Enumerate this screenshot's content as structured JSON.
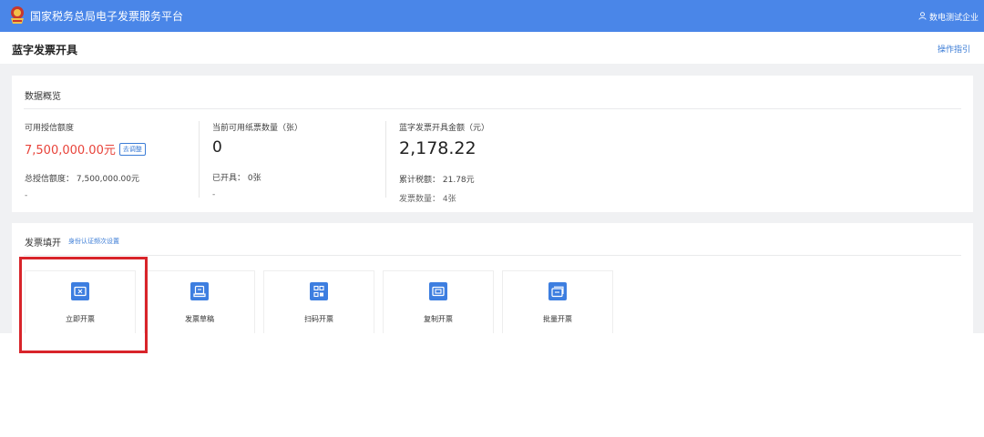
{
  "header": {
    "app_title": "国家税务总局电子发票服务平台",
    "user_name": "数电测试企业",
    "logo_icon": "tax-bureau-emblem-icon",
    "user_icon": "user-icon"
  },
  "page": {
    "title": "蓝字发票开具",
    "guide_link": "操作指引"
  },
  "overview": {
    "title": "数据概览",
    "credit": {
      "label": "可用授信额度",
      "value": "7,500,000.00元",
      "adjust_label": "去调整",
      "total_label": "总授信额度：",
      "total_value": "7,500,000.00元",
      "extra": "-"
    },
    "paper": {
      "label": "当前可用纸票数量（张）",
      "value": "0",
      "issued_label": "已开具：",
      "issued_value": "0张",
      "extra": "-"
    },
    "amount": {
      "label": "蓝字发票开具金额（元）",
      "value": "2,178.22",
      "tax_label": "累计税额：",
      "tax_value": "21.78元",
      "count_label": "发票数量：",
      "count_value": "4张"
    }
  },
  "invoice_fill": {
    "title": "发票填开",
    "auth_link": "身份认证频次设置",
    "tiles": [
      {
        "label": "立即开票",
        "icon": "ticket-icon"
      },
      {
        "label": "发票草稿",
        "icon": "draft-icon"
      },
      {
        "label": "扫码开票",
        "icon": "qr-code-icon"
      },
      {
        "label": "复制开票",
        "icon": "copy-invoice-icon"
      },
      {
        "label": "批量开票",
        "icon": "batch-invoice-icon"
      }
    ]
  },
  "colors": {
    "topbar": "#4a86e8",
    "accent": "#3d7ee0",
    "credit_value": "#e8433a",
    "highlight_box": "#d8242a"
  }
}
